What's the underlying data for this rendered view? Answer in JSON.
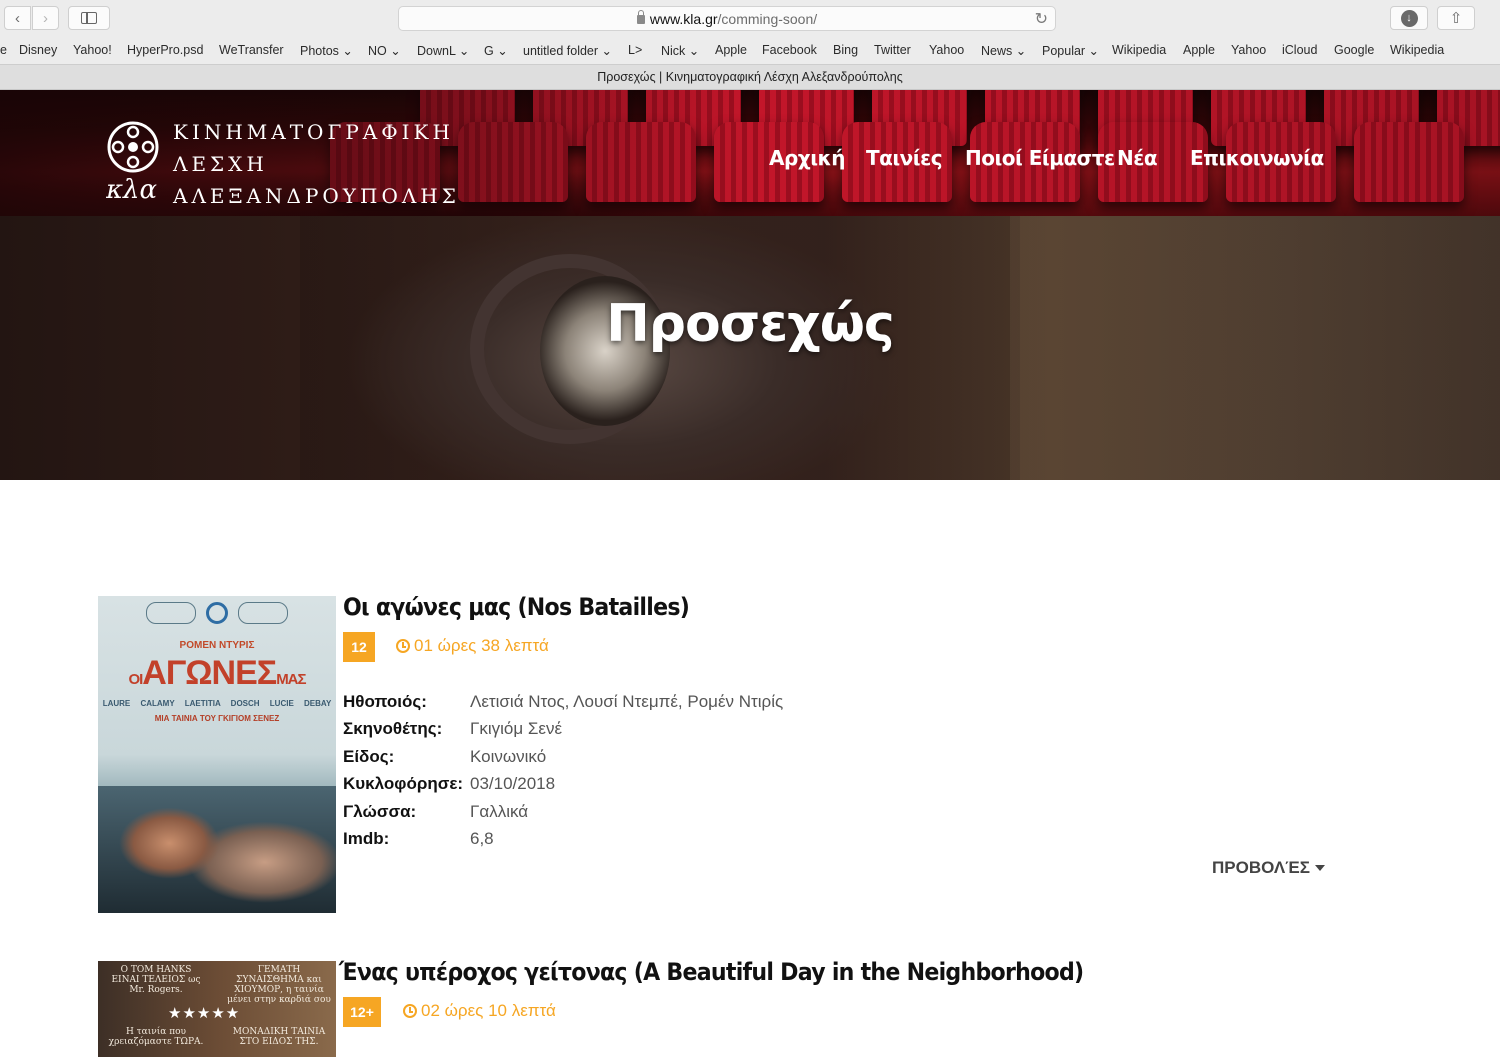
{
  "browser": {
    "url_domain": "www.kla.gr",
    "url_path": "/comming-soon/",
    "tab_title": "Προσεχώς | Κινηματογραφική Λέσχη Αλεξανδρούπολης",
    "bookmarks": [
      {
        "label": "e"
      },
      {
        "label": "Disney"
      },
      {
        "label": "Yahoo!"
      },
      {
        "label": "HyperPro.psd"
      },
      {
        "label": "WeTransfer"
      },
      {
        "label": "Photos ⌄"
      },
      {
        "label": "NO ⌄"
      },
      {
        "label": "DownL ⌄"
      },
      {
        "label": "G ⌄"
      },
      {
        "label": "untitled folder ⌄"
      },
      {
        "label": "L>"
      },
      {
        "label": "Nick ⌄"
      },
      {
        "label": "Apple"
      },
      {
        "label": "Facebook"
      },
      {
        "label": "Bing"
      },
      {
        "label": "Twitter"
      },
      {
        "label": "Yahoo"
      },
      {
        "label": "News ⌄"
      },
      {
        "label": "Popular ⌄"
      },
      {
        "label": "Wikipedia"
      },
      {
        "label": "Apple"
      },
      {
        "label": "Yahoo"
      },
      {
        "label": "iCloud"
      },
      {
        "label": "Google"
      },
      {
        "label": "Wikipedia"
      }
    ]
  },
  "site": {
    "logo_lines": [
      "ΚΙΝΗΜΑΤΟΓΡΑΦΙΚΗ",
      "ΛΕΣΧΗ",
      "ΑΛΕΞΑΝΔΡΟΥΠΟΛΗΣ"
    ],
    "logo_mark": "κλα",
    "nav": [
      "Αρχική",
      "Ταινίες",
      "Ποιοί Είμαστε",
      "Νέα",
      "Επικοινωνία"
    ],
    "hero_title": "Προσεχώς"
  },
  "movies": [
    {
      "title": "Οι αγώνες μας (Nos Batailles)",
      "rating": "12",
      "duration": "01 ώρες 38 λεπτά",
      "poster": {
        "director": "ΡΟΜΕΝ ΝΤΥΡΙΣ",
        "title_prefix": "ΟΙ",
        "title_main": "ΑΓΩΝΕΣ",
        "title_suffix": "ΜΑΣ",
        "cast": "LAURE CALAMY LAETITIA DOSCH LUCIE DEBAY",
        "credit": "ΜΙΑ ΤΑΙΝΙΑ ΤΟΥ ΓΚΙΓΙΟΜ ΣΕΝΕΖ"
      },
      "details": [
        {
          "label": "Ηθοποιός:",
          "value": "Λετισιά Ντος, Λουσί Ντεμπέ, Ρομέν Ντιρίς"
        },
        {
          "label": "Σκηνοθέτης:",
          "value": "Γκιγιόμ Σενέ"
        },
        {
          "label": "Είδος:",
          "value": "Κοινωνικό"
        },
        {
          "label": "Κυκλοφόρησε:",
          "value": "03/10/2018"
        },
        {
          "label": "Γλώσσα:",
          "value": "Γαλλικά"
        },
        {
          "label": "Imdb:",
          "value": "6,8"
        }
      ],
      "screenings_label": "ΠΡΟΒΟΛΈΣ"
    },
    {
      "title": "Ένας υπέροχος γείτονας (A Beautiful Day in the Neighborhood)",
      "rating": "12+",
      "duration": "02 ώρες 10 λεπτά",
      "poster": {
        "quote_left": "Ο TOM HANKS ΕΙΝΑΙ ΤΕΛΕΙΟΣ ως Mr. Rogers.",
        "quote_right": "ΓΕΜΑΤΗ ΣΥΝΑΙΣΘΗΜΑ και ΧΙΟΥΜΟΡ, η ταινία μένει στην καρδιά σου",
        "stars": "★★★★★",
        "quote_bottom_left": "Η ταινία που χρειαζόμαστε ΤΩΡΑ.",
        "quote_bottom_right": "ΜΟΝΑΔΙΚΗ ΤΑΙΝΙΑ ΣΤΟ ΕΙΔΟΣ ΤΗΣ."
      }
    }
  ]
}
